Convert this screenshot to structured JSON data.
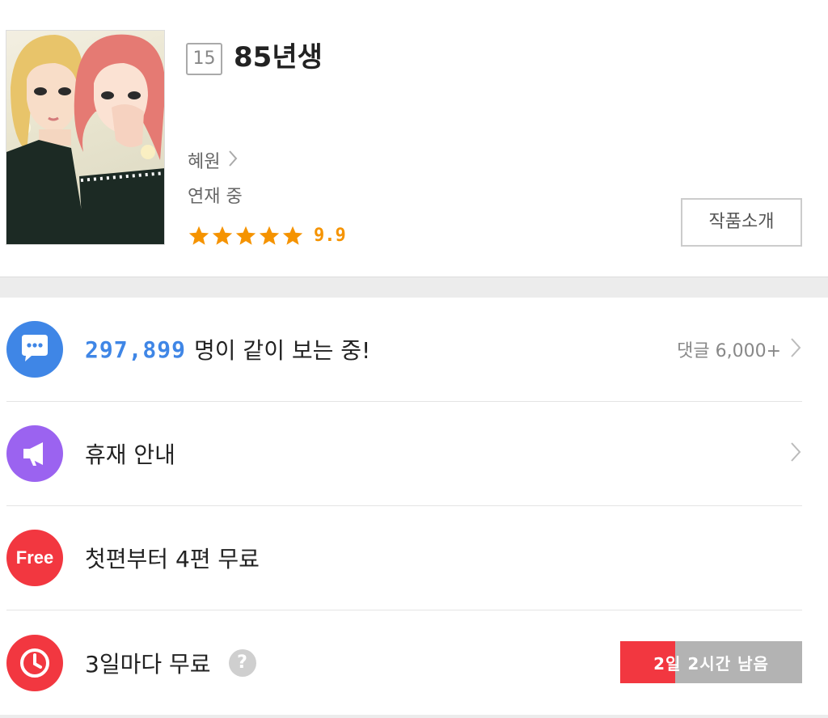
{
  "work": {
    "age_rating": "15",
    "title": "85년생",
    "author": "혜원",
    "status": "연재 중",
    "rating_value": "9.9",
    "rating_stars": 5,
    "intro_button_label": "작품소개"
  },
  "rows": {
    "viewers": {
      "icon": "chat-bubble-icon",
      "count": "297,899",
      "text": "명이 같이 보는 중!",
      "comment_label": "댓글 6,000+"
    },
    "hiatus": {
      "icon": "megaphone-icon",
      "label": "휴재 안내"
    },
    "free": {
      "icon": "free-badge-icon",
      "icon_text": "Free",
      "label": "첫편부터 4편 무료"
    },
    "wait_free": {
      "icon": "clock-icon",
      "label": "3일마다 무료",
      "help_icon": "?",
      "timer_text": "2일 2시간 남음",
      "timer_progress": 0.3
    }
  },
  "colors": {
    "accent_blue": "#3f86e6",
    "purple": "#9b63f0",
    "red": "#f23740",
    "star_orange": "#f59300",
    "timer_gray": "#b3b3b3"
  }
}
